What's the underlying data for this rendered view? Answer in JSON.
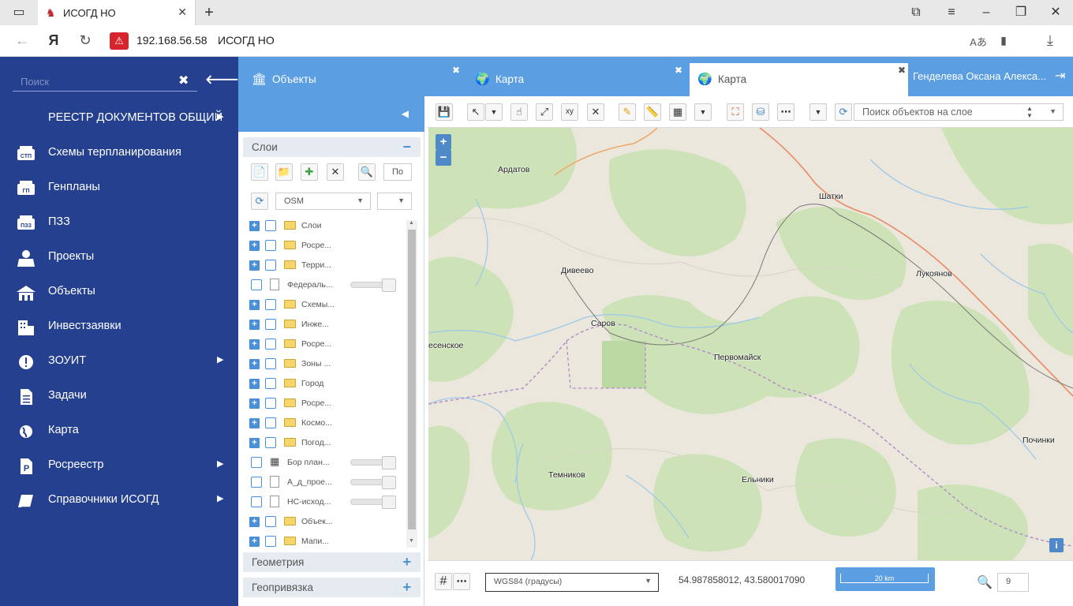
{
  "browser": {
    "tab_title": "ИСОГД НО",
    "url": "192.168.56.58",
    "page_title": "ИСОГД НО",
    "yandex_logo": "Я"
  },
  "sidebar": {
    "search_placeholder": "Поиск",
    "items": [
      {
        "label": "РЕЕСТР ДОКУМЕНТОВ ОБЩИЙ",
        "icon": "none",
        "has_submenu": true
      },
      {
        "label": "Схемы терпланирования",
        "icon": "stp-icon",
        "has_submenu": false
      },
      {
        "label": "Генпланы",
        "icon": "gp-icon",
        "has_submenu": false
      },
      {
        "label": "ПЗЗ",
        "icon": "pzz-icon",
        "has_submenu": false
      },
      {
        "label": "Проекты",
        "icon": "projects-icon",
        "has_submenu": false
      },
      {
        "label": "Объекты",
        "icon": "objects-icon",
        "has_submenu": false
      },
      {
        "label": "Инвестзаявки",
        "icon": "invest-icon",
        "has_submenu": false
      },
      {
        "label": "ЗОУИТ",
        "icon": "warning-icon",
        "has_submenu": true
      },
      {
        "label": "Задачи",
        "icon": "tasks-icon",
        "has_submenu": false
      },
      {
        "label": "Карта",
        "icon": "globe-icon",
        "has_submenu": false
      },
      {
        "label": "Росреестр",
        "icon": "rosreestr-icon",
        "has_submenu": true
      },
      {
        "label": "Справочники ИСОГД",
        "icon": "book-icon",
        "has_submenu": true
      }
    ]
  },
  "app_tabs": [
    {
      "label": "Объекты",
      "icon": "building-icon",
      "active": false
    },
    {
      "label": "Карта",
      "icon": "globe-icon",
      "active": false
    },
    {
      "label": "Карта",
      "icon": "globe-icon",
      "active": true
    }
  ],
  "user": {
    "name": "Генделева Оксана Алекса..."
  },
  "layers_panel": {
    "layers_title": "Слои",
    "filter_placeholder": "По",
    "basemap": "OSM",
    "geometry_title": "Геометрия",
    "georef_title": "Геопривязка",
    "rows": [
      {
        "name": "Слои",
        "type": "folder"
      },
      {
        "name": "Росре...",
        "type": "folder"
      },
      {
        "name": "Терри...",
        "type": "folder"
      },
      {
        "name": "Федераль...",
        "type": "doc",
        "opacity": 1
      },
      {
        "name": "Схемы...",
        "type": "folder"
      },
      {
        "name": "Инже...",
        "type": "folder"
      },
      {
        "name": "Росре...",
        "type": "folder"
      },
      {
        "name": "Зоны ...",
        "type": "folder"
      },
      {
        "name": "Город",
        "type": "folder"
      },
      {
        "name": "Росре...",
        "type": "folder"
      },
      {
        "name": "Космо...",
        "type": "folder"
      },
      {
        "name": "Погод...",
        "type": "folder"
      },
      {
        "name": "Бор план...",
        "type": "grid",
        "opacity": 1
      },
      {
        "name": "А_д_прое...",
        "type": "doc",
        "opacity": 1
      },
      {
        "name": "НС-исход...",
        "type": "doc",
        "opacity": 1
      },
      {
        "name": "Объек...",
        "type": "folder"
      },
      {
        "name": "Мапи...",
        "type": "folder"
      }
    ]
  },
  "map": {
    "search_placeholder": "Поиск объектов на слое",
    "zoom_in": "+",
    "zoom_out": "−",
    "info": "i",
    "towns": [
      {
        "name": "Ардатов"
      },
      {
        "name": "Шатки"
      },
      {
        "name": "Дивеево"
      },
      {
        "name": "Лукоянов"
      },
      {
        "name": "Саров"
      },
      {
        "name": "есенское"
      },
      {
        "name": "Первомайск"
      },
      {
        "name": "Починки"
      },
      {
        "name": "Темников"
      },
      {
        "name": "Ельники"
      }
    ]
  },
  "footer": {
    "crs": "WGS84 (градусы)",
    "coords": "54.987858012, 43.580017090",
    "scale": "20 km",
    "zoom": "9"
  },
  "colors": {
    "sidebar_bg": "#24408f",
    "tab_bar": "#5b9ee1",
    "accent": "#4a90d9",
    "map_forest": "#cde3b7",
    "map_land": "#ebe7dd",
    "map_water": "#9ec9e8",
    "map_road_orange": "#f0a86a",
    "map_border_purple": "#b48ec8"
  }
}
